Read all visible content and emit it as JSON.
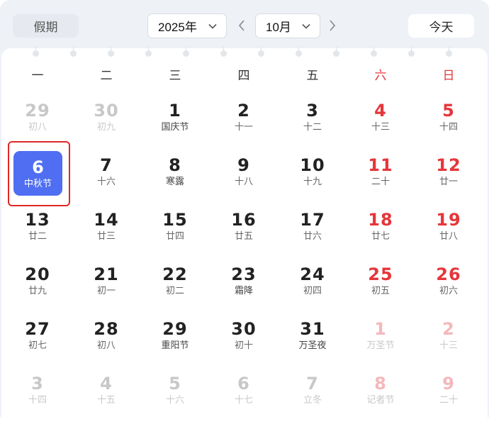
{
  "toolbar": {
    "holiday_label": "假期",
    "year_value": "2025年",
    "month_value": "10月",
    "today_label": "今天"
  },
  "weekdays": [
    "一",
    "二",
    "三",
    "四",
    "五",
    "六",
    "日"
  ],
  "selected": {
    "day": "6",
    "label": "中秋节"
  },
  "weeks": [
    [
      {
        "d": "29",
        "s": "初八"
      },
      {
        "d": "30",
        "s": "初九"
      },
      {
        "d": "1",
        "s": "国庆节"
      },
      {
        "d": "2",
        "s": "十一"
      },
      {
        "d": "3",
        "s": "十二"
      },
      {
        "d": "4",
        "s": "十三"
      },
      {
        "d": "5",
        "s": "十四"
      }
    ],
    [
      {
        "d": "6",
        "s": "中秋节"
      },
      {
        "d": "7",
        "s": "十六"
      },
      {
        "d": "8",
        "s": "寒露"
      },
      {
        "d": "9",
        "s": "十八"
      },
      {
        "d": "10",
        "s": "十九"
      },
      {
        "d": "11",
        "s": "二十"
      },
      {
        "d": "12",
        "s": "廿一"
      }
    ],
    [
      {
        "d": "13",
        "s": "廿二"
      },
      {
        "d": "14",
        "s": "廿三"
      },
      {
        "d": "15",
        "s": "廿四"
      },
      {
        "d": "16",
        "s": "廿五"
      },
      {
        "d": "17",
        "s": "廿六"
      },
      {
        "d": "18",
        "s": "廿七"
      },
      {
        "d": "19",
        "s": "廿八"
      }
    ],
    [
      {
        "d": "20",
        "s": "廿九"
      },
      {
        "d": "21",
        "s": "初一"
      },
      {
        "d": "22",
        "s": "初二"
      },
      {
        "d": "23",
        "s": "霜降"
      },
      {
        "d": "24",
        "s": "初四"
      },
      {
        "d": "25",
        "s": "初五"
      },
      {
        "d": "26",
        "s": "初六"
      }
    ],
    [
      {
        "d": "27",
        "s": "初七"
      },
      {
        "d": "28",
        "s": "初八"
      },
      {
        "d": "29",
        "s": "重阳节"
      },
      {
        "d": "30",
        "s": "初十"
      },
      {
        "d": "31",
        "s": "万圣夜"
      },
      {
        "d": "1",
        "s": "万圣节"
      },
      {
        "d": "2",
        "s": "十三"
      }
    ],
    [
      {
        "d": "3",
        "s": "十四"
      },
      {
        "d": "4",
        "s": "十五"
      },
      {
        "d": "5",
        "s": "十六"
      },
      {
        "d": "6",
        "s": "十七"
      },
      {
        "d": "7",
        "s": "立冬"
      },
      {
        "d": "8",
        "s": "记者节"
      },
      {
        "d": "9",
        "s": "二十"
      }
    ]
  ],
  "colors": {
    "accent": "#4f6ef2",
    "weekend": "#e5363b",
    "highlight_border": "#e02727"
  }
}
